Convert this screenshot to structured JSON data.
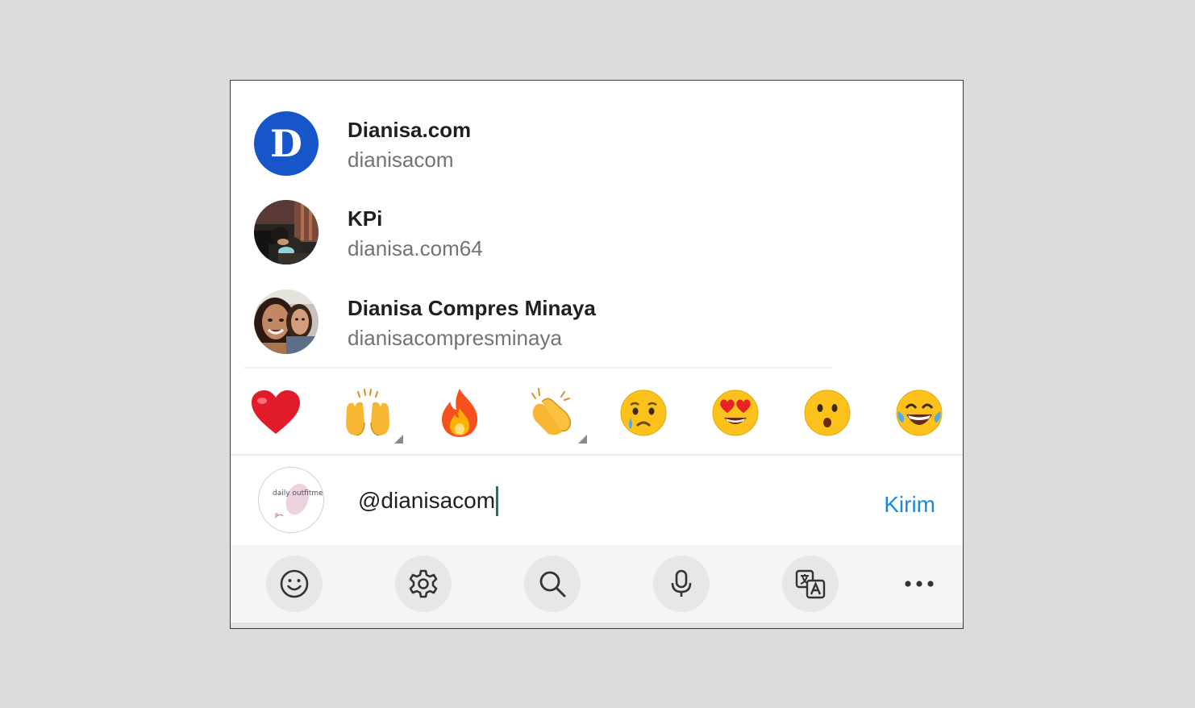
{
  "mention_suggestions": [
    {
      "name": "Dianisa.com",
      "handle": "dianisacom",
      "avatar_letter": "D"
    },
    {
      "name": "KPi",
      "handle": "dianisa.com64"
    },
    {
      "name": "Dianisa Compres Minaya",
      "handle": "dianisacompresminaya"
    }
  ],
  "emoji_bar": [
    "❤️",
    "🙌",
    "🔥",
    "👏",
    "😢",
    "😍",
    "😮",
    "😂"
  ],
  "composer": {
    "input_value": "@dianisacom",
    "send_label": "Kirim",
    "avatar_text": "daily outfitmee"
  },
  "keyboard_toolbar": {
    "icons": [
      "smiley-icon",
      "gear-icon",
      "search-icon",
      "microphone-icon",
      "translate-icon",
      "more-icon"
    ]
  },
  "colors": {
    "accent": "#1e88d6",
    "caret": "#1a7a6a",
    "avatar_d_bg": "#1656c9"
  }
}
